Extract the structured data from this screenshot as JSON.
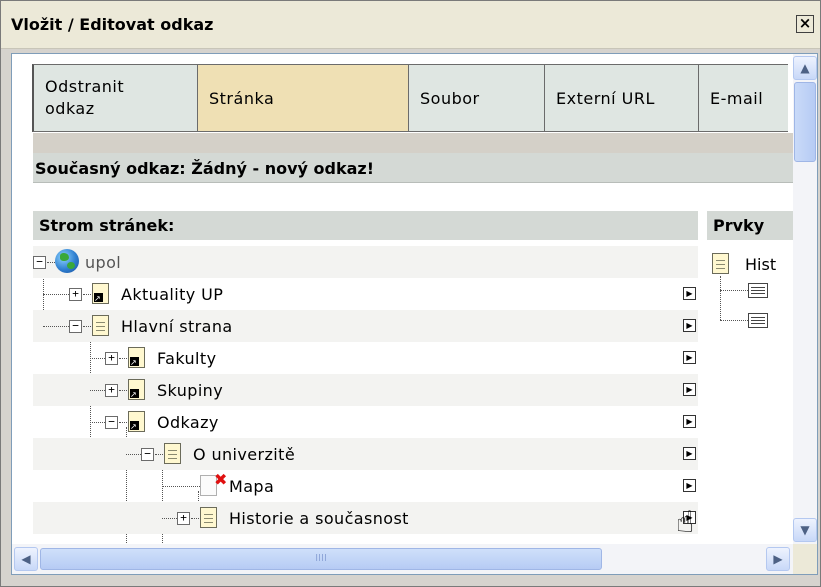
{
  "window": {
    "title": "Vložit / Editovat odkaz",
    "close_glyph": "×"
  },
  "tabs": [
    {
      "line1": "Odstranit",
      "line2": "odkaz"
    },
    {
      "label": "Stránka"
    },
    {
      "label": "Soubor"
    },
    {
      "label": "Externí URL"
    },
    {
      "label": "E-mail"
    }
  ],
  "current_link": "Současný odkaz: Žádný - nový odkaz!",
  "tree_header": "Strom stránek:",
  "elements_header": "Prvky",
  "tree": {
    "root": "upol",
    "items": [
      {
        "label": "Aktuality UP",
        "expander": "+"
      },
      {
        "label": "Hlavní strana",
        "expander": "−"
      },
      {
        "label": "Fakulty",
        "expander": "+"
      },
      {
        "label": "Skupiny",
        "expander": "+"
      },
      {
        "label": "Odkazy",
        "expander": "−"
      },
      {
        "label": "O univerzitě",
        "expander": "−"
      },
      {
        "label": "Mapa",
        "expander": ""
      },
      {
        "label": "Historie a současnost",
        "expander": "+"
      }
    ]
  },
  "elements": {
    "label": "Hist"
  },
  "action_glyph": "▶",
  "cursor_glyph": "☝",
  "scroll": {
    "up": "▲",
    "down": "▼",
    "left": "◀",
    "right": "▶",
    "grip": "IIII"
  },
  "icons": [
    "globe-icon",
    "page-icon",
    "page-link-icon",
    "missing-page-icon",
    "content-element-icon",
    "hand-cursor-icon"
  ]
}
